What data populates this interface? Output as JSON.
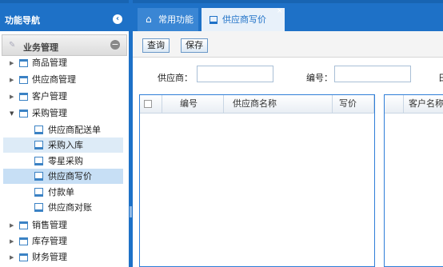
{
  "sidebar": {
    "title": "功能导航",
    "group_label": "业务管理",
    "tree": [
      {
        "label": "商品管理"
      },
      {
        "label": "供应商管理"
      },
      {
        "label": "客户管理"
      },
      {
        "label": "采购管理"
      },
      {
        "label": "销售管理"
      },
      {
        "label": "库存管理"
      },
      {
        "label": "财务管理"
      }
    ],
    "purchase_children": [
      {
        "label": "供应商配送单"
      },
      {
        "label": "采购入库"
      },
      {
        "label": "零星采购"
      },
      {
        "label": "供应商写价"
      },
      {
        "label": "付款单"
      },
      {
        "label": "供应商对账"
      }
    ]
  },
  "tabs": {
    "home": "常用功能",
    "active": "供应商写价"
  },
  "toolbar": {
    "query": "查询",
    "save": "保存"
  },
  "filters": {
    "supplier_label": "供应商：",
    "code_label": "编号：",
    "third_label_partial": "日"
  },
  "grid_left": {
    "columns": [
      "编号",
      "供应商名称",
      "写价"
    ]
  },
  "grid_right": {
    "columns": [
      "客户名称"
    ]
  }
}
